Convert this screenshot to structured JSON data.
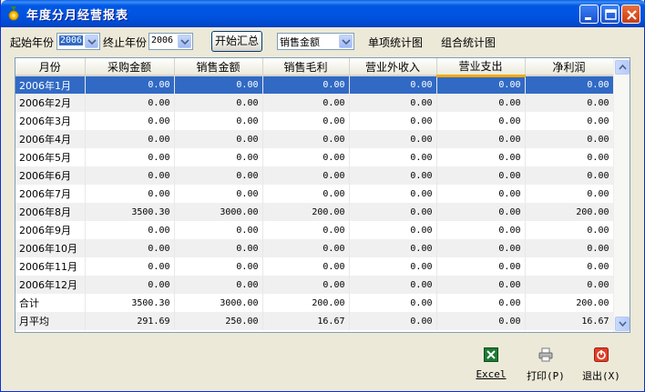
{
  "window": {
    "title": "年度分月经营报表"
  },
  "toolbar": {
    "start_year_label": "起始年份",
    "start_year_value": "2006",
    "end_year_label": "终止年份",
    "end_year_value": "2006",
    "summarize_button": "开始汇总",
    "metric_select_value": "销售金额",
    "single_chart_link": "单项统计图",
    "combined_chart_link": "组合统计图"
  },
  "table": {
    "columns": [
      "月份",
      "采购金额",
      "销售金额",
      "销售毛利",
      "营业外收入",
      "营业支出",
      "净利润"
    ],
    "rows": [
      [
        "2006年1月",
        "0.00",
        "0.00",
        "0.00",
        "0.00",
        "0.00",
        "0.00"
      ],
      [
        "2006年2月",
        "0.00",
        "0.00",
        "0.00",
        "0.00",
        "0.00",
        "0.00"
      ],
      [
        "2006年3月",
        "0.00",
        "0.00",
        "0.00",
        "0.00",
        "0.00",
        "0.00"
      ],
      [
        "2006年4月",
        "0.00",
        "0.00",
        "0.00",
        "0.00",
        "0.00",
        "0.00"
      ],
      [
        "2006年5月",
        "0.00",
        "0.00",
        "0.00",
        "0.00",
        "0.00",
        "0.00"
      ],
      [
        "2006年6月",
        "0.00",
        "0.00",
        "0.00",
        "0.00",
        "0.00",
        "0.00"
      ],
      [
        "2006年7月",
        "0.00",
        "0.00",
        "0.00",
        "0.00",
        "0.00",
        "0.00"
      ],
      [
        "2006年8月",
        "3500.30",
        "3000.00",
        "200.00",
        "0.00",
        "0.00",
        "200.00"
      ],
      [
        "2006年9月",
        "0.00",
        "0.00",
        "0.00",
        "0.00",
        "0.00",
        "0.00"
      ],
      [
        "2006年10月",
        "0.00",
        "0.00",
        "0.00",
        "0.00",
        "0.00",
        "0.00"
      ],
      [
        "2006年11月",
        "0.00",
        "0.00",
        "0.00",
        "0.00",
        "0.00",
        "0.00"
      ],
      [
        "2006年12月",
        "0.00",
        "0.00",
        "0.00",
        "0.00",
        "0.00",
        "0.00"
      ],
      [
        "合计",
        "3500.30",
        "3000.00",
        "200.00",
        "0.00",
        "0.00",
        "200.00"
      ],
      [
        "月平均",
        "291.69",
        "250.00",
        "16.67",
        "0.00",
        "0.00",
        "16.67"
      ]
    ]
  },
  "actions": {
    "excel_label": "Excel",
    "print_label": "打印(P)",
    "exit_label": "退出(X)"
  },
  "icons": {
    "app": "medal-icon",
    "minimize": "minimize-icon",
    "maximize": "maximize-icon",
    "close": "close-icon",
    "excel": "excel-icon",
    "print": "printer-icon",
    "exit": "power-icon"
  },
  "colors": {
    "selection": "#316AC5",
    "titlebar": "#0053DF",
    "active_header_underline": "#F8A900"
  }
}
